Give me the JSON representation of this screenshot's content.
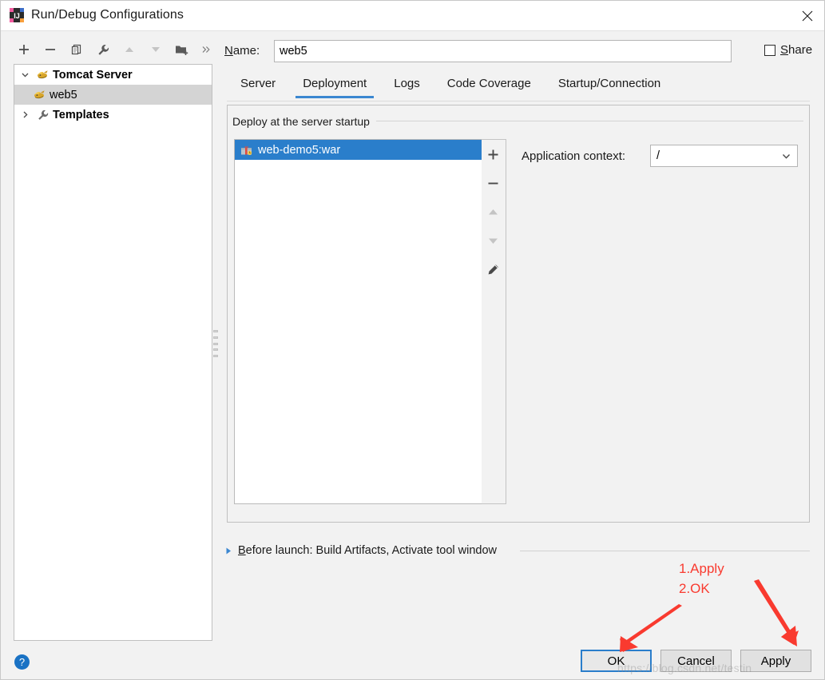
{
  "window": {
    "title": "Run/Debug Configurations",
    "app_icon": "intellij-idea-icon",
    "close_icon": "close-icon"
  },
  "left_panel": {
    "toolbar": [
      {
        "name": "add-configuration-button",
        "icon": "plus-icon",
        "label": "+",
        "enabled": true
      },
      {
        "name": "remove-configuration-button",
        "icon": "minus-icon",
        "label": "−",
        "enabled": true
      },
      {
        "name": "copy-configuration-button",
        "icon": "copy-icon",
        "label": "copy",
        "enabled": true
      },
      {
        "name": "edit-templates-button",
        "icon": "wrench-icon",
        "label": "wrench",
        "enabled": true
      },
      {
        "name": "move-up-button",
        "icon": "arrow-up-icon",
        "label": "up",
        "enabled": false
      },
      {
        "name": "move-down-button",
        "icon": "arrow-down-icon",
        "label": "down",
        "enabled": false
      },
      {
        "name": "new-folder-button",
        "icon": "folder-add-icon",
        "label": "folder",
        "enabled": true
      },
      {
        "name": "more-options-button",
        "icon": "chevron-double-right-icon",
        "label": "»",
        "enabled": true
      }
    ],
    "tree": [
      {
        "label": "Tomcat Server",
        "icon": "tomcat-icon",
        "expanded": true,
        "selected": false,
        "twisty": "chevron-down",
        "level": 0
      },
      {
        "label": "web5",
        "icon": "tomcat-icon",
        "expanded": false,
        "selected": true,
        "twisty": "",
        "level": 1
      },
      {
        "label": "Templates",
        "icon": "wrench-icon",
        "expanded": false,
        "selected": false,
        "twisty": "chevron-right",
        "level": 0
      }
    ]
  },
  "name_row": {
    "label": "Name:",
    "label_mnemonic": "N",
    "value": "web5",
    "placeholder": "",
    "share_label": "Share",
    "share_mnemonic": "S",
    "share_checked": false
  },
  "tabs": [
    {
      "label": "Server",
      "active": false
    },
    {
      "label": "Deployment",
      "active": true
    },
    {
      "label": "Logs",
      "active": false
    },
    {
      "label": "Code Coverage",
      "active": false
    },
    {
      "label": "Startup/Connection",
      "active": false
    }
  ],
  "deployment": {
    "group_title": "Deploy at the server startup",
    "artifacts": [
      {
        "label": "web-demo5:war",
        "icon": "artifact-icon",
        "selected": true
      }
    ],
    "list_toolbar": [
      {
        "name": "add-artifact-button",
        "icon": "plus-icon",
        "label": "+",
        "enabled": true
      },
      {
        "name": "remove-artifact-button",
        "icon": "minus-icon",
        "label": "−",
        "enabled": true
      },
      {
        "name": "move-artifact-up-button",
        "icon": "arrow-up-icon",
        "label": "up",
        "enabled": false
      },
      {
        "name": "move-artifact-down-button",
        "icon": "arrow-down-icon",
        "label": "down",
        "enabled": false
      },
      {
        "name": "edit-artifact-button",
        "icon": "pencil-icon",
        "label": "edit",
        "enabled": true
      }
    ],
    "application_context": {
      "label": "Application context:",
      "value": "/",
      "chevron_icon": "chevron-down-icon"
    }
  },
  "before_launch": {
    "triangle_icon": "triangle-right-icon",
    "label": "Before launch: Build Artifacts, Activate tool window",
    "label_mnemonic": "B"
  },
  "footer": {
    "help_label": "?",
    "help_icon": "help-icon",
    "buttons": [
      {
        "name": "ok-button",
        "label": "OK",
        "focused": true
      },
      {
        "name": "cancel-button",
        "label": "Cancel",
        "focused": false
      },
      {
        "name": "apply-button",
        "label": "Apply",
        "focused": false
      }
    ]
  },
  "annotations": {
    "accent_color": "#f93a2f",
    "line1": "1.Apply",
    "line2": "2.OK",
    "arrow_to_ok": "arrow-pointing-to-ok-button",
    "arrow_to_apply": "arrow-pointing-to-apply-button",
    "watermark": "https://blog.csdn.net/testin"
  },
  "colors": {
    "dialog_bg": "#f2f2f2",
    "selection_blue": "#2a7ecb",
    "tab_underline": "#3b87d1",
    "help_blue": "#1a72c4"
  }
}
